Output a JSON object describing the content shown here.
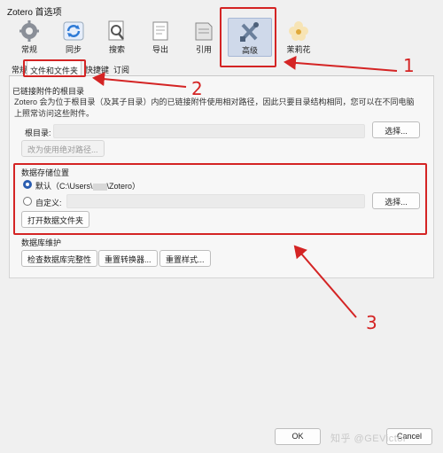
{
  "window": {
    "title": "Zotero 首选项"
  },
  "toolbar": {
    "panes": [
      {
        "label": "常规",
        "icon": "gear-icon"
      },
      {
        "label": "同步",
        "icon": "sync-icon"
      },
      {
        "label": "搜索",
        "icon": "search-icon"
      },
      {
        "label": "导出",
        "icon": "export-icon"
      },
      {
        "label": "引用",
        "icon": "cite-icon"
      },
      {
        "label": "高级",
        "icon": "advanced-tools-icon",
        "active": true
      },
      {
        "label": "茉莉花",
        "icon": "jasmine-flower-icon"
      }
    ]
  },
  "tabs": [
    "常规",
    "文件和文件夹",
    "快捷键",
    "订阅"
  ],
  "linked_attachments": {
    "title": "已链接附件的根目录",
    "description": "Zotero 会为位于根目录（及其子目录）内的已链接附件使用相对路径，因此只要目录结构相同，您可以在不同电脑上照常访问这些附件。",
    "base_dir_label": "根目录:",
    "choose_label": "选择...",
    "revert_label": "改为使用绝对路径..."
  },
  "data_location": {
    "title": "数据存储位置",
    "default_label_prefix": "默认（C:\\Users\\",
    "default_label_suffix": "\\Zotero）",
    "custom_label": "自定义:",
    "choose_label": "选择...",
    "open_folder_label": "打开数据文件夹"
  },
  "db_maintenance": {
    "title": "数据库维护",
    "check_label": "检查数据库完整性",
    "reset_translators_label": "重置转换器...",
    "reset_styles_label": "重置样式..."
  },
  "footer": {
    "ok_label": "OK",
    "cancel_label": "Cancel"
  },
  "annotations": [
    "1",
    "2",
    "3"
  ],
  "watermark": "知乎 @GEVictor",
  "colors": {
    "annotation_red": "#d42424",
    "accent_blue": "#2a5db0",
    "active_pane_bg": "#cfd9ea"
  }
}
